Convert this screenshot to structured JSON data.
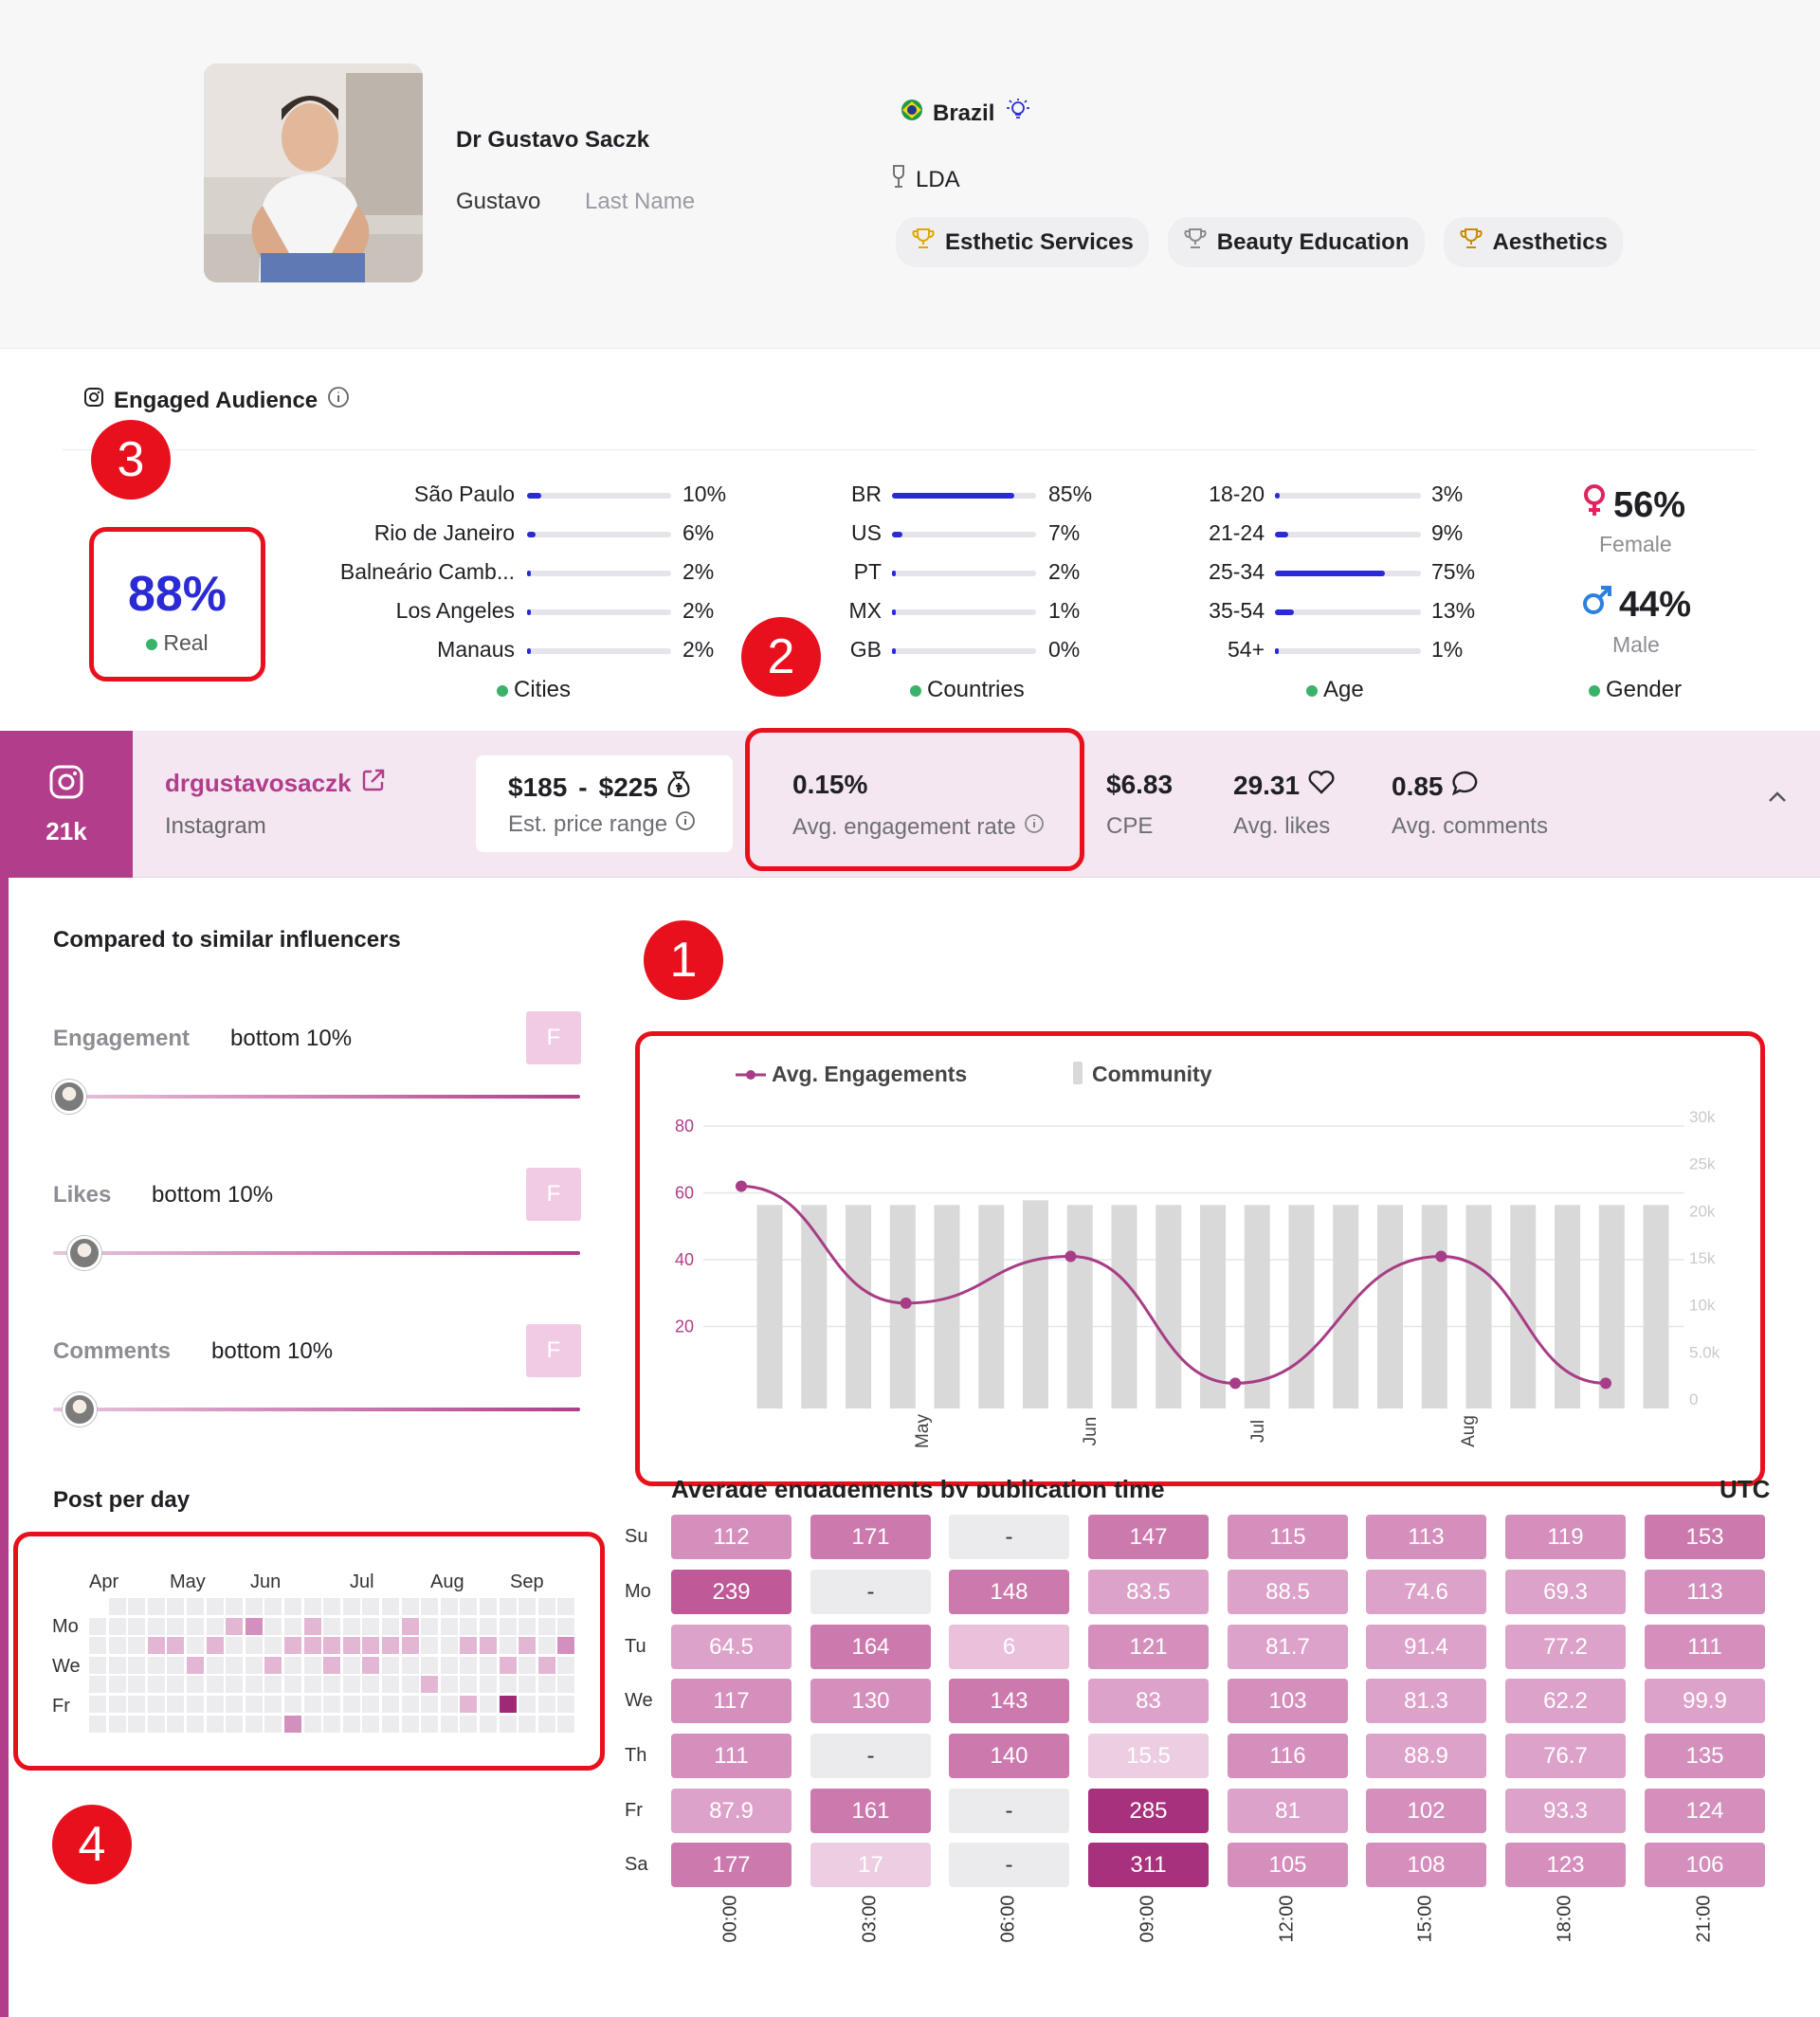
{
  "profile": {
    "full_name": "Dr Gustavo Saczk",
    "first_name": "Gustavo",
    "last_name_placeholder": "Last Name",
    "country": "Brazil",
    "language": "LDA",
    "tags": [
      "Esthetic Services",
      "Beauty Education",
      "Aesthetics"
    ]
  },
  "audience": {
    "title": "Engaged Audience",
    "real_pct": "88%",
    "real_label": "Real",
    "cities": {
      "label": "Cities",
      "items": [
        {
          "name": "São Paulo",
          "pct": "10%",
          "value": 0.1
        },
        {
          "name": "Rio de Janeiro",
          "pct": "6%",
          "value": 0.06
        },
        {
          "name": "Balneário Camb...",
          "pct": "2%",
          "value": 0.02
        },
        {
          "name": "Los Angeles",
          "pct": "2%",
          "value": 0.02
        },
        {
          "name": "Manaus",
          "pct": "2%",
          "value": 0.02
        }
      ]
    },
    "countries": {
      "label": "Countries",
      "items": [
        {
          "name": "BR",
          "pct": "85%",
          "value": 0.85
        },
        {
          "name": "US",
          "pct": "7%",
          "value": 0.07
        },
        {
          "name": "PT",
          "pct": "2%",
          "value": 0.02
        },
        {
          "name": "MX",
          "pct": "1%",
          "value": 0.01
        },
        {
          "name": "GB",
          "pct": "0%",
          "value": 0.0
        }
      ]
    },
    "age": {
      "label": "Age",
      "items": [
        {
          "name": "18-20",
          "pct": "3%",
          "value": 0.03
        },
        {
          "name": "21-24",
          "pct": "9%",
          "value": 0.09
        },
        {
          "name": "25-34",
          "pct": "75%",
          "value": 0.75
        },
        {
          "name": "35-54",
          "pct": "13%",
          "value": 0.13
        },
        {
          "name": "54+",
          "pct": "1%",
          "value": 0.01
        }
      ]
    },
    "gender": {
      "label": "Gender",
      "female_pct": "56%",
      "female_label": "Female",
      "male_pct": "44%",
      "male_label": "Male"
    }
  },
  "annotations": [
    "1",
    "2",
    "3",
    "4"
  ],
  "account": {
    "followers": "21k",
    "handle": "drgustavosaczk",
    "platform": "Instagram",
    "price_low": "$185",
    "price_sep": "-",
    "price_high": "$225",
    "price_label": "Est. price range",
    "engagement_rate": "0.15%",
    "engagement_rate_label": "Avg. engagement rate",
    "cpe": "$6.83",
    "cpe_label": "CPE",
    "avg_likes": "29.31",
    "avg_likes_label": "Avg. likes",
    "avg_comments": "0.85",
    "avg_comments_label": "Avg. comments"
  },
  "comparison": {
    "title": "Compared to similar influencers",
    "items": [
      {
        "name": "Engagement",
        "value": "bottom 10%",
        "grade": "F",
        "level": 0.03
      },
      {
        "name": "Likes",
        "value": "bottom 10%",
        "grade": "F",
        "level": 0.06
      },
      {
        "name": "Comments",
        "value": "bottom 10%",
        "grade": "F",
        "level": 0.05
      }
    ]
  },
  "posts_per_day": {
    "title": "Post per day",
    "months": [
      "Apr",
      "May",
      "Jun",
      "Jul",
      "Aug",
      "Sep"
    ],
    "day_labels": [
      "Mo",
      "We",
      "Fr"
    ]
  },
  "chart_data": {
    "type": "line",
    "legend": [
      "Avg. Engagements",
      "Community"
    ],
    "x_tick_labels": [
      "May",
      "Jun",
      "Jul",
      "Aug"
    ],
    "y_left_ticks": [
      "20",
      "40",
      "60",
      "80"
    ],
    "y_right_ticks": [
      "0",
      "5.0k",
      "10k",
      "15k",
      "20k",
      "25k",
      "30k"
    ],
    "series": [
      {
        "name": "Avg. Engagements",
        "x": [
          0,
          4,
          8,
          12,
          17,
          21
        ],
        "values": [
          62,
          27,
          41,
          3,
          41,
          3
        ]
      },
      {
        "name": "Community",
        "values": [
          20000,
          20000,
          20000,
          20000,
          20000,
          20000,
          20500,
          20000,
          20000,
          20000,
          20000,
          20000,
          20000,
          20000,
          20000,
          20000,
          20000,
          20000,
          20000,
          20000,
          20000
        ]
      }
    ],
    "ylim_left": [
      0,
      80
    ],
    "ylim_right": [
      0,
      30000
    ],
    "colors": {
      "line": "#a83c86",
      "bars": "#d9d9d9"
    }
  },
  "heatmap": {
    "title": "Average engagements by publication time",
    "timezone": "UTC",
    "rows": [
      "Su",
      "Mo",
      "Tu",
      "We",
      "Th",
      "Fr",
      "Sa"
    ],
    "cols": [
      "00:00",
      "03:00",
      "06:00",
      "09:00",
      "12:00",
      "15:00",
      "18:00",
      "21:00"
    ],
    "values": [
      [
        "112",
        "171",
        "-",
        "147",
        "115",
        "113",
        "119",
        "153"
      ],
      [
        "239",
        "-",
        "148",
        "83.5",
        "88.5",
        "74.6",
        "69.3",
        "113"
      ],
      [
        "64.5",
        "164",
        "6",
        "121",
        "81.7",
        "91.4",
        "77.2",
        "111"
      ],
      [
        "117",
        "130",
        "143",
        "83",
        "103",
        "81.3",
        "62.2",
        "99.9"
      ],
      [
        "111",
        "-",
        "140",
        "15.5",
        "116",
        "88.9",
        "76.7",
        "135"
      ],
      [
        "87.9",
        "161",
        "-",
        "285",
        "81",
        "102",
        "93.3",
        "124"
      ],
      [
        "177",
        "17",
        "-",
        "311",
        "105",
        "108",
        "123",
        "106"
      ]
    ]
  }
}
